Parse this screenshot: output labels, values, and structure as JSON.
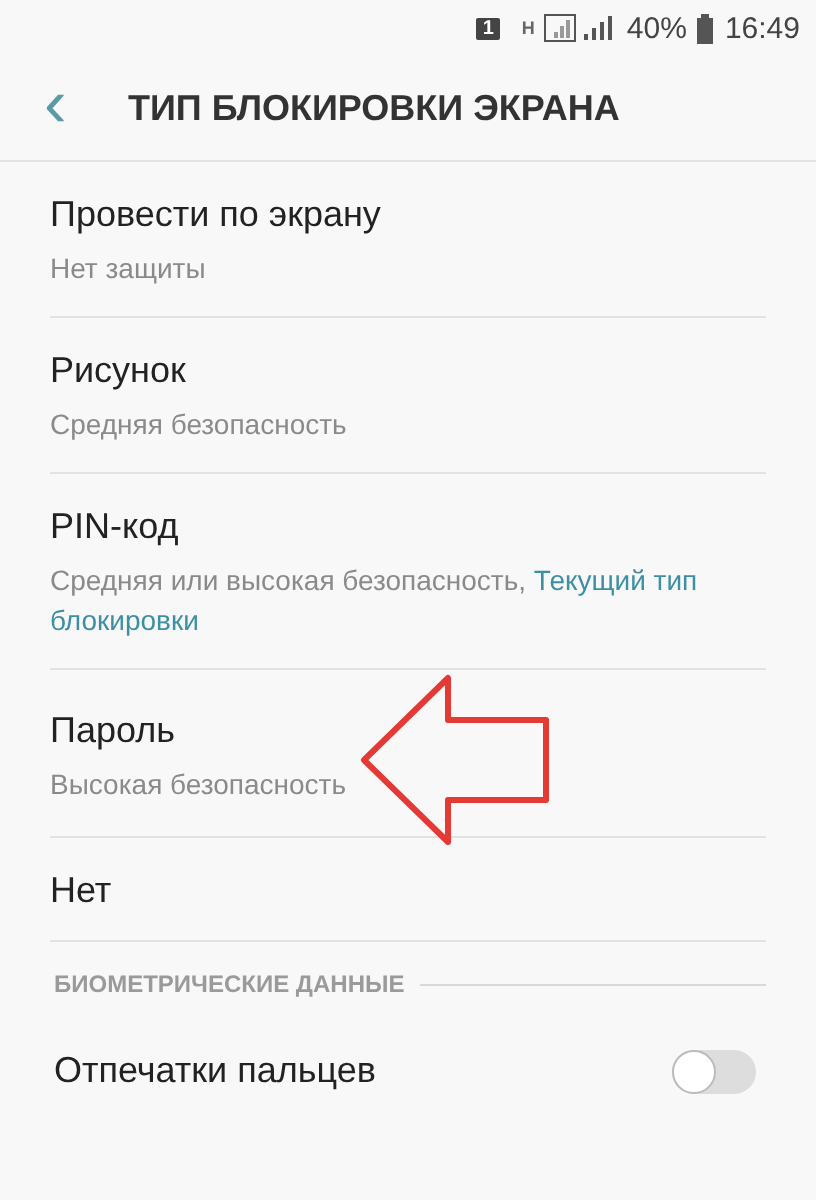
{
  "status_bar": {
    "sim": "1",
    "network": "H",
    "battery": "40%",
    "time": "16:49"
  },
  "header": {
    "back": "‹",
    "title": "ТИП БЛОКИРОВКИ ЭКРАНА"
  },
  "options": [
    {
      "title": "Провести по экрану",
      "subtitle": "Нет защиты"
    },
    {
      "title": "Рисунок",
      "subtitle": "Средняя безопасность"
    },
    {
      "title": "PIN-код",
      "subtitle": "Средняя или высокая безопасность, ",
      "note": "Текущий тип блокировки"
    },
    {
      "title": "Пароль",
      "subtitle": "Высокая безопасность"
    },
    {
      "title": "Нет"
    }
  ],
  "section": {
    "title": "БИОМЕТРИЧЕСКИЕ ДАННЫЕ",
    "items": [
      {
        "title": "Отпечатки пальцев",
        "on": false
      }
    ]
  }
}
